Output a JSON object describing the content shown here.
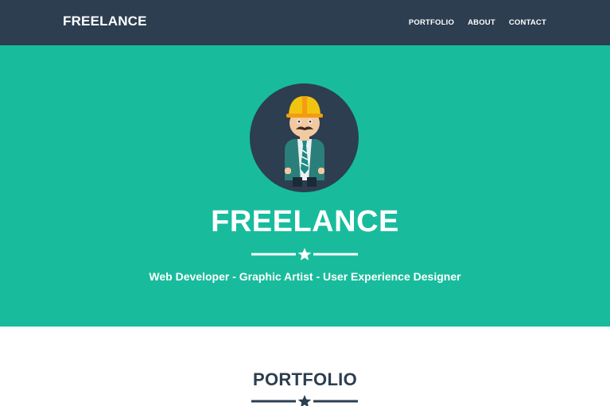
{
  "navbar": {
    "brand": "FREELANCE",
    "links": [
      "PORTFOLIO",
      "ABOUT",
      "CONTACT"
    ]
  },
  "hero": {
    "title": "FREELANCE",
    "subtitle": "Web Developer - Graphic Artist - User Experience Designer",
    "avatar_icon": "profile-avatar-icon",
    "divider_icon": "star-icon"
  },
  "portfolio": {
    "title": "PORTFOLIO",
    "divider_icon": "star-icon"
  },
  "colors": {
    "navbar_bg": "#2c3e50",
    "hero_bg": "#18bc9c",
    "text_light": "#ffffff",
    "text_dark": "#2c3e50",
    "hard_hat": "#f1c40f"
  }
}
